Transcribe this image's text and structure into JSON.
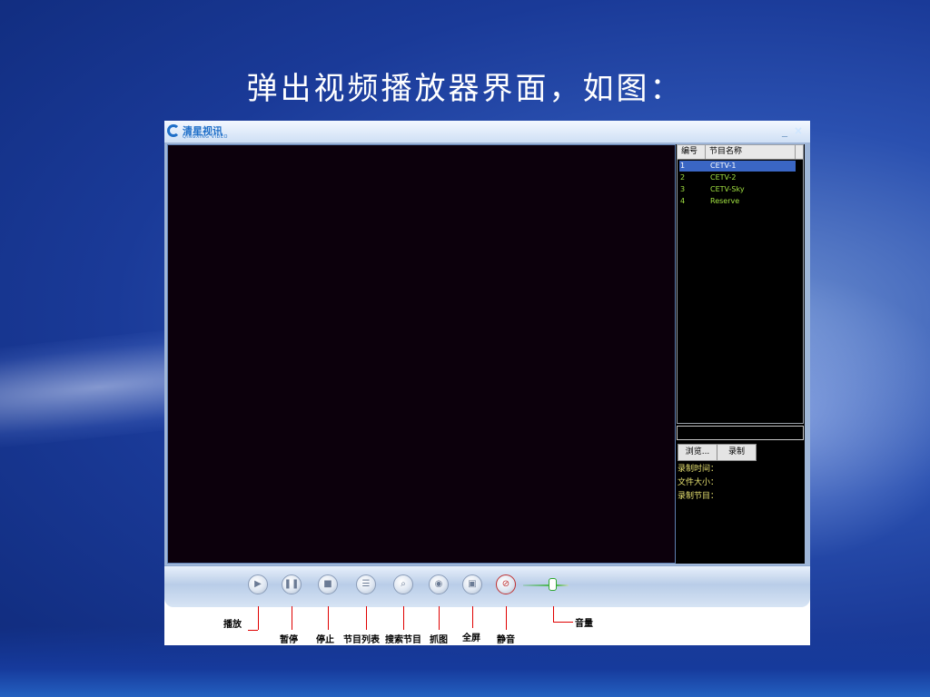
{
  "slide": {
    "title": "弹出视频播放器界面，如图："
  },
  "window": {
    "logo_text": "清星视讯",
    "logo_sub": "QINGXING VIDEO",
    "minimize": "_",
    "close": "×"
  },
  "channel_list": {
    "columns": [
      "编号",
      "节目名称"
    ],
    "rows": [
      {
        "num": "1",
        "name": "CETV-1",
        "selected": true
      },
      {
        "num": "2",
        "name": "CETV-2",
        "selected": false
      },
      {
        "num": "3",
        "name": "CETV-Sky",
        "selected": false
      },
      {
        "num": "4",
        "name": "Reserve",
        "selected": false
      }
    ]
  },
  "record": {
    "browse_label": "浏览...",
    "record_label": "录制",
    "time_label": "录制时间：",
    "size_label": "文件大小：",
    "program_label": "录制节目："
  },
  "controls": {
    "play_icon": "▶",
    "pause_icon": "❚❚",
    "stop_icon": "■",
    "list_icon": "☰",
    "search_icon": "⌕",
    "snapshot_icon": "◉",
    "fullscreen_icon": "▣",
    "mute_icon": "⊘",
    "volume_level": 0.6
  },
  "annotations": {
    "play": "播放",
    "pause": "暂停",
    "stop": "停止",
    "program_list": "节目列表",
    "search_program": "搜索节目",
    "snapshot": "抓图",
    "fullscreen": "全屏",
    "mute": "静音",
    "volume": "音量"
  },
  "colors": {
    "video_bg": "#0c000c",
    "list_text": "#a0e040",
    "selection": "#3a66c4",
    "record_text": "#e6e070",
    "annotation_line": "#e00000"
  }
}
